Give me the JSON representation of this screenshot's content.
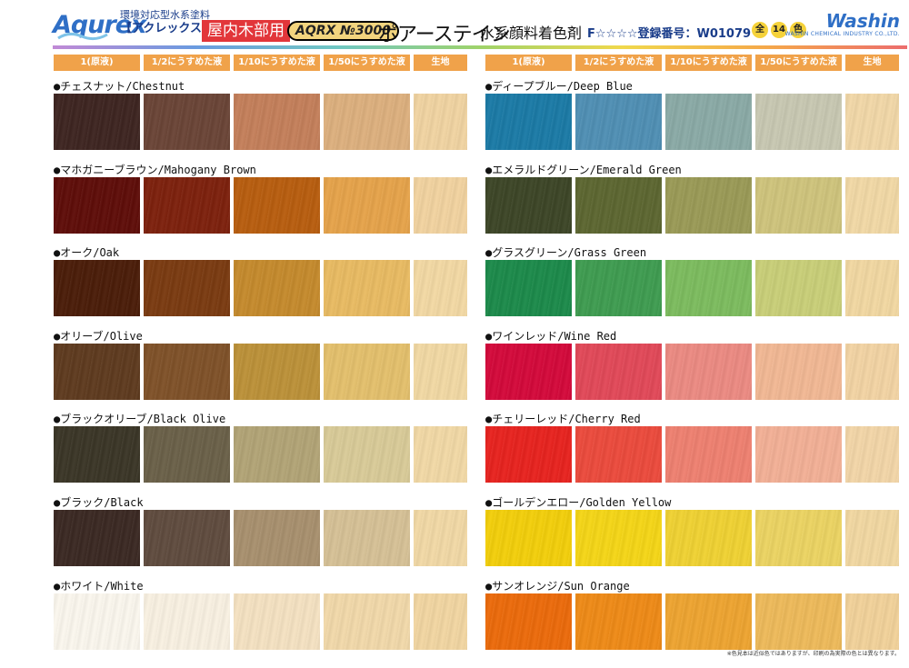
{
  "header": {
    "logo_text": "Aqurex",
    "brand_sub": "環境対応型水系塗料",
    "brand_name": "【アクレックス】",
    "usage_badge": "屋内木部用",
    "model_badge": "AQRX №3000",
    "product_name": "ポアーステイン",
    "product_type": "水系顔料着色剤",
    "registration": "F☆☆☆☆登録番号：W01079",
    "count": [
      "全",
      "14",
      "色"
    ],
    "maker_logo": "Washin",
    "maker_sub": "WASHIN CHEMICAL INDUSTRY CO.,LTD."
  },
  "columns": [
    "1(原液)",
    "1/2にうすめた液",
    "1/10にうすめた液",
    "1/50にうすめた液",
    "生地"
  ],
  "colors": {
    "header_bar": "#f0a24a",
    "usage_badge": "#e2363a",
    "brand_blue": "#2f6fc6"
  },
  "left_groups": [
    {
      "label": "●チェスナット/Chestnut",
      "swatches": [
        "#3d2420",
        "#6a4436",
        "#c47f5a",
        "#ddb07e",
        "#f1d4a2"
      ]
    },
    {
      "label": "●マホガニーブラウン/Mahogany Brown",
      "swatches": [
        "#5e0c08",
        "#7d200c",
        "#b85d0e",
        "#e6a34a",
        "#f2d3a0"
      ]
    },
    {
      "label": "●オーク/Oak",
      "swatches": [
        "#4a1c08",
        "#7a3a10",
        "#c58a2c",
        "#e9bb62",
        "#f3d9a4"
      ]
    },
    {
      "label": "●オリーブ/Olive",
      "swatches": [
        "#5e3a1e",
        "#7f5128",
        "#bc9138",
        "#e4c06c",
        "#f2d9a4"
      ]
    },
    {
      "label": "●ブラックオリーブ/Black Olive",
      "swatches": [
        "#3a3526",
        "#6a6048",
        "#b2a476",
        "#d9cb98",
        "#f2d9a6"
      ]
    },
    {
      "label": "●ブラック/Black",
      "swatches": [
        "#3a2822",
        "#5f4b3e",
        "#a8906e",
        "#d6c196",
        "#f2d9a6"
      ]
    },
    {
      "label": "●ホワイト/White",
      "swatches": [
        "#fbf7ee",
        "#f9f1e2",
        "#f5e2c2",
        "#f2d9aa",
        "#f2d6a2"
      ]
    }
  ],
  "right_groups": [
    {
      "label": "●ディープブルー/Deep Blue",
      "swatches": [
        "#1a7aa6",
        "#4f8fb4",
        "#8aaaa6",
        "#c8c8b2",
        "#f2d8a8"
      ]
    },
    {
      "label": "●エメラルドグリーン/Emerald Green",
      "swatches": [
        "#3c4526",
        "#5c6630",
        "#9a9a56",
        "#cfc47c",
        "#f2d9a6"
      ]
    },
    {
      "label": "●グラスグリーン/Grass Green",
      "swatches": [
        "#1b8a4a",
        "#3e9c50",
        "#7cbc5e",
        "#c9cf78",
        "#f2d8a2"
      ]
    },
    {
      "label": "●ワインレッド/Wine Red",
      "swatches": [
        "#d4083a",
        "#e24858",
        "#ec8a82",
        "#f2b894",
        "#f3d4a4"
      ]
    },
    {
      "label": "●チェリーレッド/Cherry Red",
      "swatches": [
        "#e8221e",
        "#ec4a3c",
        "#ef8070",
        "#f3b096",
        "#f3d6a8"
      ]
    },
    {
      "label": "●ゴールデンエロー/Golden Yellow",
      "swatches": [
        "#f3cf0a",
        "#f5d616",
        "#f0d232",
        "#ecd462",
        "#f2d8a2"
      ]
    },
    {
      "label": "●サンオレンジ/Sun Orange",
      "swatches": [
        "#ec6a0a",
        "#ef8a16",
        "#eea430",
        "#eeba5a",
        "#f2d29a"
      ]
    }
  ],
  "footnote": "※色見本は近似色ではありますが、印刷の為実際の色とは異なります。"
}
